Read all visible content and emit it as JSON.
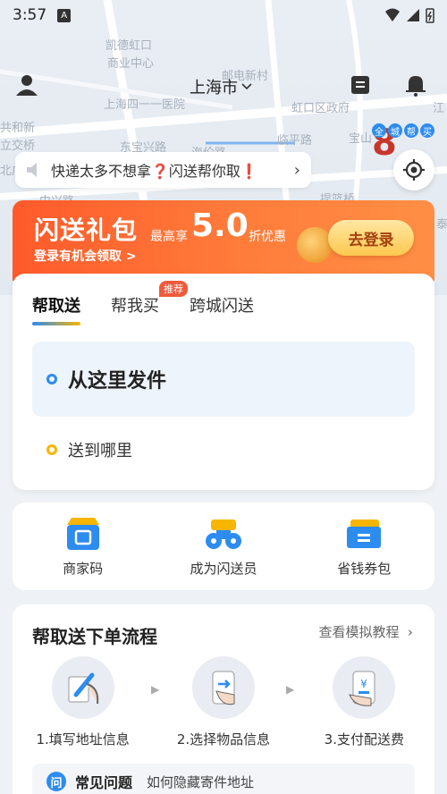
{
  "status": {
    "time": "3:57",
    "badge": "A"
  },
  "map": {
    "labels": [
      "凯德虹口",
      "商业中心",
      "邮电新村",
      "上海四一一医院",
      "虹口区政府",
      "江",
      "共和新",
      "立交桥",
      "东宝兴路",
      "海伦路",
      "临平路",
      "宝山",
      "中兴路",
      "提篮桥",
      "泰",
      "北广"
    ]
  },
  "header": {
    "city": "上海市"
  },
  "notice": {
    "text": "快递太多不想拿❓闪送帮你取❗"
  },
  "map_badge": {
    "number": "8",
    "chips": [
      "全",
      "城",
      "帮",
      "买"
    ]
  },
  "promo": {
    "title": "闪送礼包",
    "prefix": "最高享",
    "value": "5.0",
    "suffix": "折优惠",
    "subtitle": "登录有机会领取 >",
    "button": "去登录"
  },
  "order": {
    "tabs": [
      {
        "label": "帮取送"
      },
      {
        "label": "帮我买",
        "badge": "推荐"
      },
      {
        "label": "跨城闪送"
      }
    ],
    "from_placeholder": "从这里发件",
    "to_placeholder": "送到哪里"
  },
  "shortcuts": [
    {
      "label": "商家码",
      "icon": "store-qr-icon"
    },
    {
      "label": "成为闪送员",
      "icon": "courier-icon"
    },
    {
      "label": "省钱券包",
      "icon": "coupon-icon"
    }
  ],
  "flow": {
    "title": "帮取送下单流程",
    "more": "查看模拟教程",
    "steps": [
      {
        "label": "1.填写地址信息",
        "icon": "write-address-icon"
      },
      {
        "label": "2.选择物品信息",
        "icon": "select-item-icon"
      },
      {
        "label": "3.支付配送费",
        "icon": "pay-icon"
      }
    ]
  },
  "faq": {
    "title": "常见问题",
    "question": "如何隐藏寄件地址"
  }
}
